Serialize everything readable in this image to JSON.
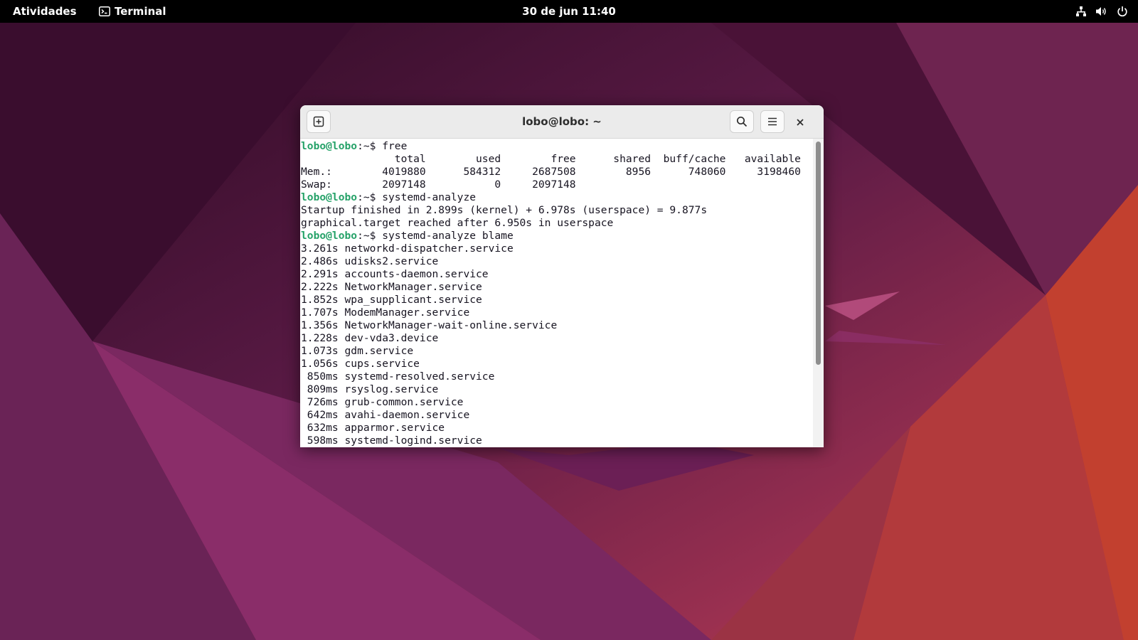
{
  "topbar": {
    "activities_label": "Atividades",
    "app_label": "Terminal",
    "clock": "30 de jun 11:40",
    "icons": [
      "network-icon",
      "volume-icon",
      "power-icon"
    ]
  },
  "window": {
    "title": "lobo@lobo: ~",
    "buttons": [
      "new-tab-icon",
      "search-icon",
      "hamburger-menu-icon",
      "close-icon"
    ]
  },
  "terminal": {
    "lines": [
      {
        "prompt": "lobo@lobo",
        "suffix": ":~$ ",
        "text": "free"
      },
      {
        "text": "               total        used        free      shared  buff/cache   available"
      },
      {
        "text": "Mem.:        4019880      584312     2687508        8956      748060     3198460"
      },
      {
        "text": "Swap:        2097148           0     2097148"
      },
      {
        "prompt": "lobo@lobo",
        "suffix": ":~$ ",
        "text": "systemd-analyze"
      },
      {
        "text": "Startup finished in 2.899s (kernel) + 6.978s (userspace) = 9.877s"
      },
      {
        "text": "graphical.target reached after 6.950s in userspace"
      },
      {
        "prompt": "lobo@lobo",
        "suffix": ":~$ ",
        "text": "systemd-analyze blame"
      },
      {
        "text": "3.261s networkd-dispatcher.service"
      },
      {
        "text": "2.486s udisks2.service"
      },
      {
        "text": "2.291s accounts-daemon.service"
      },
      {
        "text": "2.222s NetworkManager.service"
      },
      {
        "text": "1.852s wpa_supplicant.service"
      },
      {
        "text": "1.707s ModemManager.service"
      },
      {
        "text": "1.356s NetworkManager-wait-online.service"
      },
      {
        "text": "1.228s dev-vda3.device"
      },
      {
        "text": "1.073s gdm.service"
      },
      {
        "text": "1.056s cups.service"
      },
      {
        "text": " 850ms systemd-resolved.service"
      },
      {
        "text": " 809ms rsyslog.service"
      },
      {
        "text": " 726ms grub-common.service"
      },
      {
        "text": " 642ms avahi-daemon.service"
      },
      {
        "text": " 632ms apparmor.service"
      },
      {
        "text": " 598ms systemd-logind.service"
      }
    ],
    "colors": {
      "prompt": "#26a269",
      "text": "#171421",
      "background": "#ffffff"
    }
  }
}
